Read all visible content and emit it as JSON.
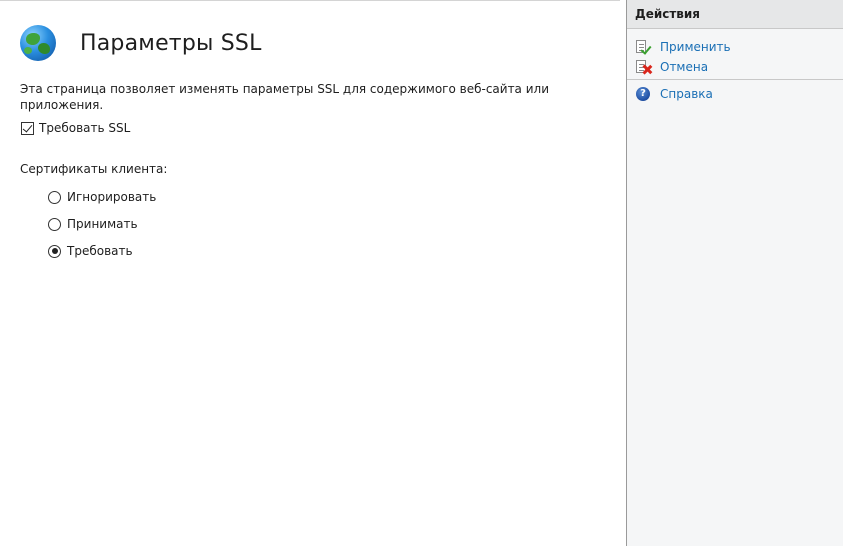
{
  "main": {
    "title": "Параметры SSL",
    "description": "Эта страница позволяет изменять параметры SSL для содержимого веб-сайта или приложения.",
    "require_ssl": {
      "label": "Требовать SSL",
      "checked": true
    },
    "client_certs": {
      "label": "Сертификаты клиента:",
      "options": [
        {
          "label": "Игнорировать",
          "selected": false
        },
        {
          "label": "Принимать",
          "selected": false
        },
        {
          "label": "Требовать",
          "selected": true
        }
      ]
    }
  },
  "actions": {
    "header": "Действия",
    "apply": "Применить",
    "cancel": "Отмена",
    "help": "Справка",
    "help_glyph": "?"
  },
  "icons": {
    "page_icon": "globe-icon",
    "apply_icon": "document-check-icon",
    "cancel_icon": "document-cross-icon",
    "help_icon": "help-circle-icon"
  },
  "colors": {
    "link": "#1a6fb5",
    "apply_check": "#3aa02f",
    "cancel_cross": "#d9261c",
    "panel_bg": "#f5f6f7",
    "panel_header_bg": "#e6e7e8"
  }
}
